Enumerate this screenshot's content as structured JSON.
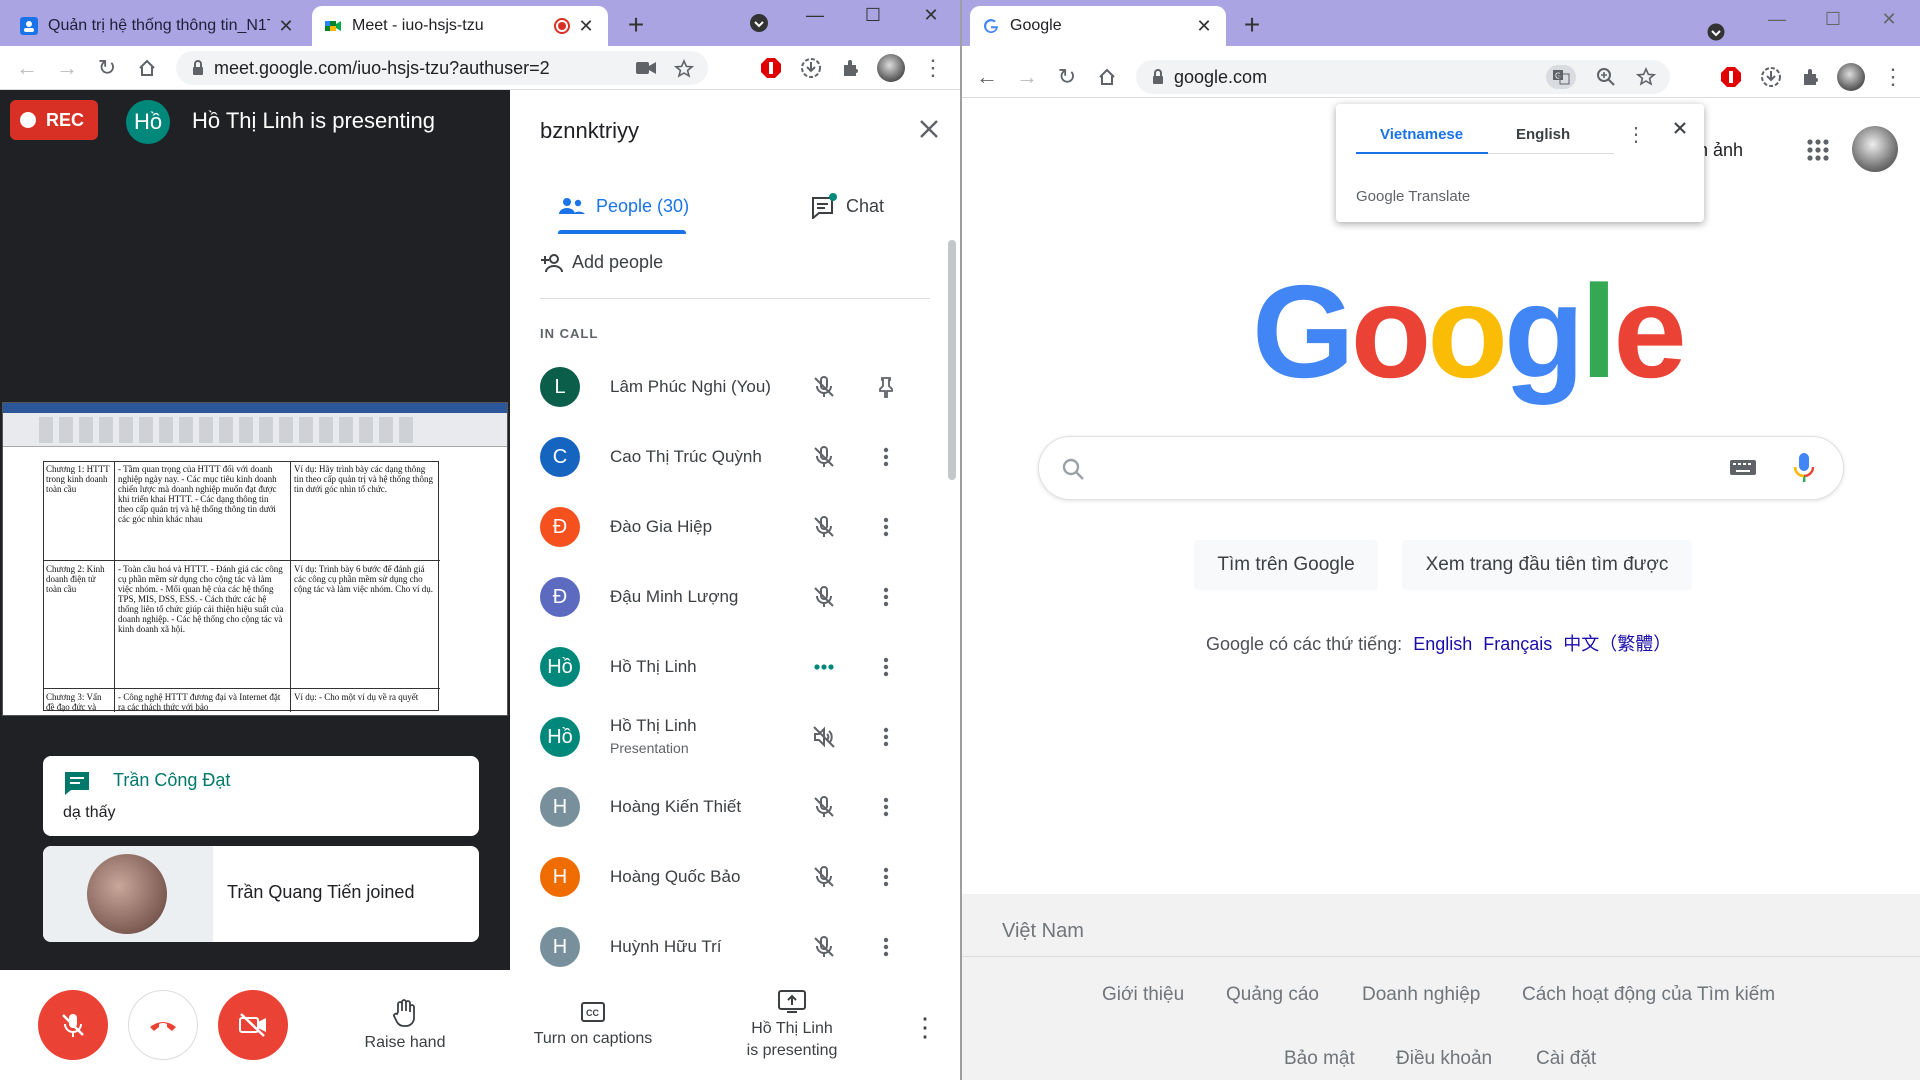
{
  "left_browser": {
    "tabs": [
      {
        "title": "Quản trị hệ thống thông tin_N1T",
        "active": false
      },
      {
        "title": "Meet - iuo-hsjs-tzu",
        "active": true
      }
    ],
    "url": "meet.google.com/iuo-hsjs-tzu?authuser=2"
  },
  "meet": {
    "rec_label": "REC",
    "presenter_initial": "Hồ",
    "presenting_text": "Hồ Thị Linh is presenting",
    "screen_share": {
      "rows": [
        {
          "chapter": "Chương 1: HTTT trong kinh doanh toàn cầu",
          "content": "- Tầm quan trọng của HTTT đối với doanh nghiệp ngày nay. - Các mục tiêu kinh doanh chiến lược mà doanh nghiệp muốn đạt được khi triển khai HTTT. - Các dạng thông tin theo cấp quản trị và hệ thống thông tin dưới các góc nhìn khác nhau",
          "example": "Ví dụ: Hãy trình bày các dạng thông tin theo cấp quản trị và hệ thống thông tin dưới góc nhìn tổ chức."
        },
        {
          "chapter": "Chương 2: Kinh doanh điện tử toàn cầu",
          "content": "- Toàn cầu hoá và HTTT. - Đánh giá các công cụ phần mềm sử dụng cho cộng tác và làm việc nhóm. - Mối quan hệ của các hệ thống TPS, MIS, DSS, ESS. - Cách thức các hệ thống liên tổ chức giúp cải thiện hiệu suất của doanh nghiệp. - Các hệ thống cho cộng tác và kinh doanh xã hội.",
          "example": "Ví dụ: Trình bày 6 bước để đánh giá các công cụ phần mềm sử dụng cho cộng tác và làm việc nhóm. Cho ví dụ."
        },
        {
          "chapter": "Chương 3: Vấn đề đạo đức và",
          "content": "- Công nghệ HTTT đương đại và Internet đặt ra các thách thức với bảo",
          "example": "Ví dụ: - Cho một ví dụ về ra quyết"
        }
      ]
    },
    "chat_toast": {
      "sender": "Trần Công Đạt",
      "message": "dạ thấy"
    },
    "join_toast": {
      "text": "Trần Quang Tiến joined"
    },
    "controls": {
      "raise_hand": "Raise hand",
      "captions": "Turn on captions",
      "presenting_line1": "Hồ Thị Linh",
      "presenting_line2": "is presenting"
    },
    "panel": {
      "title": "bznnktriyy",
      "people_tab": "People (30)",
      "chat_tab": "Chat",
      "add_people": "Add people",
      "in_call_label": "IN CALL",
      "participants": [
        {
          "initial": "L",
          "name": "Lâm Phúc Nghi (You)",
          "sub": "",
          "color": "#0b5e4a",
          "mic": "muted",
          "action": "pin"
        },
        {
          "initial": "C",
          "name": "Cao Thị Trúc Quỳnh",
          "sub": "",
          "color": "#1565c0",
          "mic": "muted",
          "action": "more"
        },
        {
          "initial": "Đ",
          "name": "Đào Gia Hiệp",
          "sub": "",
          "color": "#f4511e",
          "mic": "muted",
          "action": "more"
        },
        {
          "initial": "Đ",
          "name": "Đậu Minh Lượng",
          "sub": "",
          "color": "#5c6bc0",
          "mic": "muted",
          "action": "more"
        },
        {
          "initial": "Hồ",
          "name": "Hồ Thị Linh",
          "sub": "",
          "color": "#00897b",
          "mic": "speaking",
          "action": "more"
        },
        {
          "initial": "Hồ",
          "name": "Hồ Thị Linh",
          "sub": "Presentation",
          "color": "#00897b",
          "mic": "audio-off",
          "action": "more"
        },
        {
          "initial": "H",
          "name": "Hoàng Kiến Thiết",
          "sub": "",
          "color": "#78909c",
          "mic": "muted",
          "action": "more"
        },
        {
          "initial": "H",
          "name": "Hoàng Quốc Bảo",
          "sub": "",
          "color": "#ef6c00",
          "mic": "muted",
          "action": "more"
        },
        {
          "initial": "H",
          "name": "Huỳnh Hữu Trí",
          "sub": "",
          "color": "#78909c",
          "mic": "muted",
          "action": "more"
        }
      ]
    }
  },
  "right_browser": {
    "tabs": [
      {
        "title": "Google",
        "active": true
      }
    ],
    "url": "google.com"
  },
  "google": {
    "images_link": "nh ảnh",
    "logo_letters": [
      {
        "ch": "G",
        "color": "#4285f4"
      },
      {
        "ch": "o",
        "color": "#ea4335"
      },
      {
        "ch": "o",
        "color": "#fbbc05"
      },
      {
        "ch": "g",
        "color": "#4285f4"
      },
      {
        "ch": "l",
        "color": "#34a853"
      },
      {
        "ch": "e",
        "color": "#ea4335"
      }
    ],
    "search_button": "Tìm trên Google",
    "lucky_button": "Xem trang đầu tiên tìm được",
    "languages_prefix": "Google có các thứ tiếng:",
    "languages": [
      "English",
      "Français",
      "中文（繁體）"
    ],
    "country": "Việt Nam",
    "footer_row1": [
      "Giới thiệu",
      "Quảng cáo",
      "Doanh nghiệp",
      "Cách hoạt động của Tìm kiếm"
    ],
    "footer_row2": [
      "Bảo mật",
      "Điều khoản",
      "Cài đặt"
    ],
    "translate_popup": {
      "tab_vi": "Vietnamese",
      "tab_en": "English",
      "brand": "Google Translate"
    }
  }
}
